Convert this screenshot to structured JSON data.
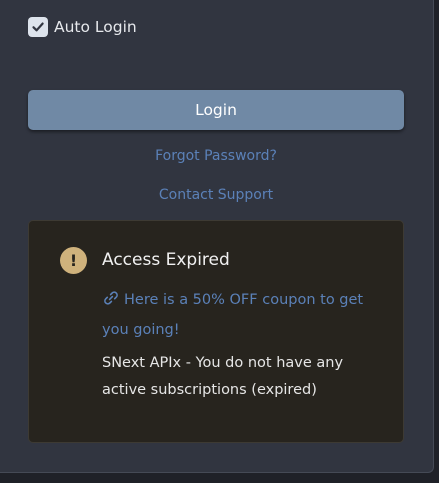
{
  "auto_login": {
    "label": "Auto Login",
    "checked": true
  },
  "login_button": {
    "label": "Login"
  },
  "links": {
    "forgot_password": "Forgot Password?",
    "contact_support": "Contact Support"
  },
  "alert": {
    "icon": "exclamation-icon",
    "title": "Access Expired",
    "coupon_text": "Here is a 50% OFF coupon to get you going!",
    "message": "SNext APIx - You do not have any active subscriptions (expired)"
  },
  "colors": {
    "background": "#313540",
    "button": "#7089a5",
    "link": "#5b81b8",
    "alert_background": "#27241e",
    "alert_icon": "#cfb27c"
  }
}
